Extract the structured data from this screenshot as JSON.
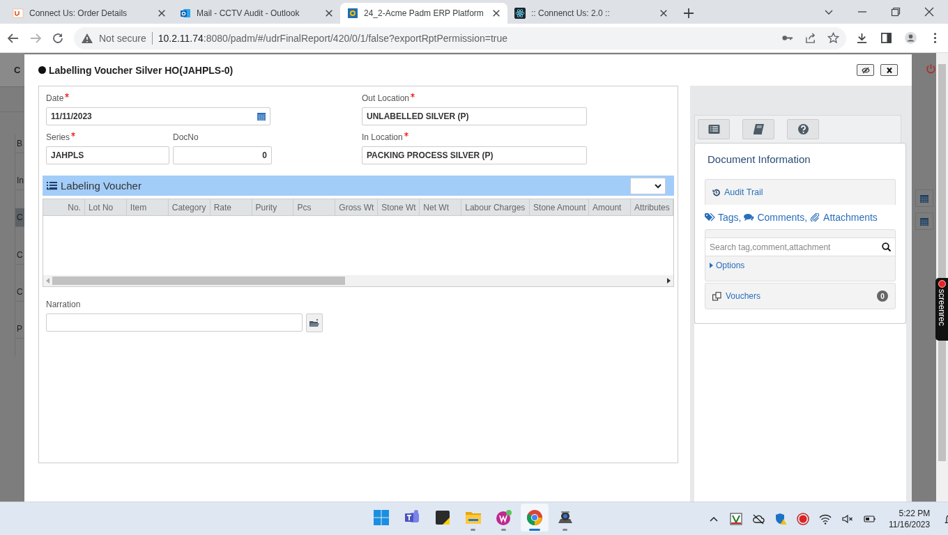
{
  "browser": {
    "tabs": [
      {
        "kind": "connect",
        "title": "Connect Us: Order Details",
        "selected": false
      },
      {
        "kind": "mail",
        "title": "Mail - CCTV Audit - Outlook",
        "selected": false
      },
      {
        "kind": "erp",
        "title": "24_2-Acme Padm ERP Platform",
        "selected": true
      },
      {
        "kind": "react",
        "title": ":: Connenct Us: 2.0 ::",
        "selected": false
      }
    ],
    "security": "Not secure",
    "url_host": "10.2.11.74",
    "url_rest": ":8080/padm/#/udrFinalReport/420/0/1/false?exportRptPermission=true"
  },
  "background_page": {
    "header": "C",
    "rows": [
      {
        "text": "B",
        "selected": false
      },
      {
        "text": "In",
        "selected": false
      },
      {
        "text": "C",
        "selected": true
      },
      {
        "text": "C",
        "selected": false
      },
      {
        "text": "C",
        "selected": false
      },
      {
        "text": "P",
        "selected": false
      }
    ]
  },
  "modal": {
    "title": "Labelling Voucher Silver HO(JAHPLS-0)",
    "fields": {
      "date": {
        "label": "Date",
        "required": true,
        "value": "11/11/2023"
      },
      "series": {
        "label": "Series",
        "required": true,
        "value": "JAHPLS"
      },
      "doc_no": {
        "label": "DocNo",
        "required": false,
        "value": "0"
      },
      "out_location": {
        "label": "Out Location",
        "required": true,
        "value": "UNLABELLED SILVER (P)"
      },
      "in_location": {
        "label": "In Location",
        "required": true,
        "value": "PACKING PROCESS SILVER (P)"
      }
    },
    "grid": {
      "title": "Labeling Voucher",
      "columns": [
        "No.",
        "Lot No",
        "Item",
        "Category",
        "Rate",
        "Purity",
        "Pcs",
        "Gross Wt",
        "Stone Wt",
        "Net Wt",
        "Labour Charges",
        "Stone Amount",
        "Amount",
        "Attributes"
      ]
    },
    "narration": {
      "label": "Narration"
    },
    "side_panel": {
      "heading": "Document Information",
      "audit_trail": "Audit Trail",
      "tags": "Tags,",
      "comments": "Comments,",
      "attachments": "Attachments",
      "search_placeholder": "Search tag,comment,attachment",
      "options": "Options",
      "vouchers": "Vouchers",
      "vouchers_count": "0"
    }
  },
  "recorder_badge": "screenrec",
  "taskbar": {
    "apps": [
      {
        "kind": "windows",
        "running": false,
        "selected": false
      },
      {
        "kind": "teams",
        "running": false,
        "selected": false
      },
      {
        "kind": "notes",
        "running": false,
        "selected": false
      },
      {
        "kind": "folder",
        "running": true,
        "selected": false
      },
      {
        "kind": "wps",
        "running": true,
        "selected": false
      },
      {
        "kind": "chrome",
        "running": true,
        "selected": true
      },
      {
        "kind": "camera",
        "running": true,
        "selected": false
      }
    ],
    "time": "5:22 PM",
    "date": "11/16/2023"
  }
}
